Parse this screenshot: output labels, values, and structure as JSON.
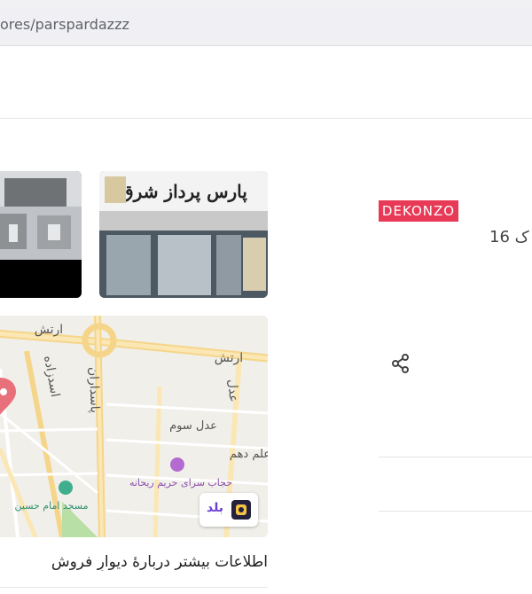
{
  "browser": {
    "url": "ores/parspardazzz"
  },
  "store": {
    "sign_text": "پارس پرداز شرق",
    "brand_logo": "DEKONZO",
    "item_count": "ک 16"
  },
  "map": {
    "labels": {
      "artesh_left": "ارتش",
      "artesh_right": "ارتش",
      "asadzadeh": "اسدزاده",
      "pasdaran": "پاسداران",
      "adl": "عدل",
      "adl_sevom": "عدل سوم",
      "elm_dahom": "علم دهم",
      "hejab": "حجاب سرای حریم ریحانه",
      "masjed": "مسجد امام حسین"
    },
    "badge_label": "بلد"
  },
  "learn_more": "اطلاعات بیشتر دربارهٔ دیوارِ فروش",
  "icons": {
    "share": "share-icon",
    "map_pin": "map-pin-icon",
    "balad_logo": "balad-logo-icon"
  },
  "colors": {
    "brand_logo_bg": "#e83a56",
    "map_badge_text": "#6b3fd6"
  }
}
